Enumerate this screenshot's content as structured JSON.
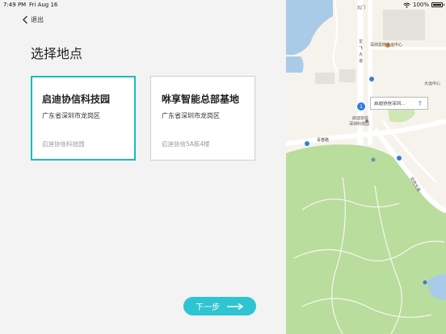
{
  "status_bar": {
    "time": "7:49 PM",
    "date": "Fri Aug 16",
    "battery": "100%"
  },
  "nav": {
    "back_label": "退出"
  },
  "page": {
    "title": "选择地点"
  },
  "locations": [
    {
      "name": "启迪协信科技园",
      "region": "广东省深圳市龙岗区",
      "detail": "启迪协信科技园",
      "selected": true
    },
    {
      "name": "咻享智能总部基地",
      "region": "广东省深圳市龙岗区",
      "detail": "启迪协信5A栋4楼",
      "selected": false
    }
  ],
  "actions": {
    "next_label": "下一步"
  },
  "map": {
    "callout_text": "启迪协信深圳...",
    "labels": {
      "shopping_center": "深圳龙岗大运中心",
      "road_vertical_1": "龙",
      "road_vertical_2": "飞",
      "road_vertical_3": "大",
      "road_vertical_4": "道",
      "place_1": "启迪协信",
      "place_2": "深圳科技园",
      "road_qingchun": "青春路",
      "right_edge": "大运中心",
      "road_diag": "龙岗大道",
      "top_label": "北门"
    }
  },
  "colors": {
    "accent": "#17bdc0",
    "button": "#2ec4d2",
    "map_green": "#b9dd9c",
    "map_water": "#a9cbe8"
  }
}
